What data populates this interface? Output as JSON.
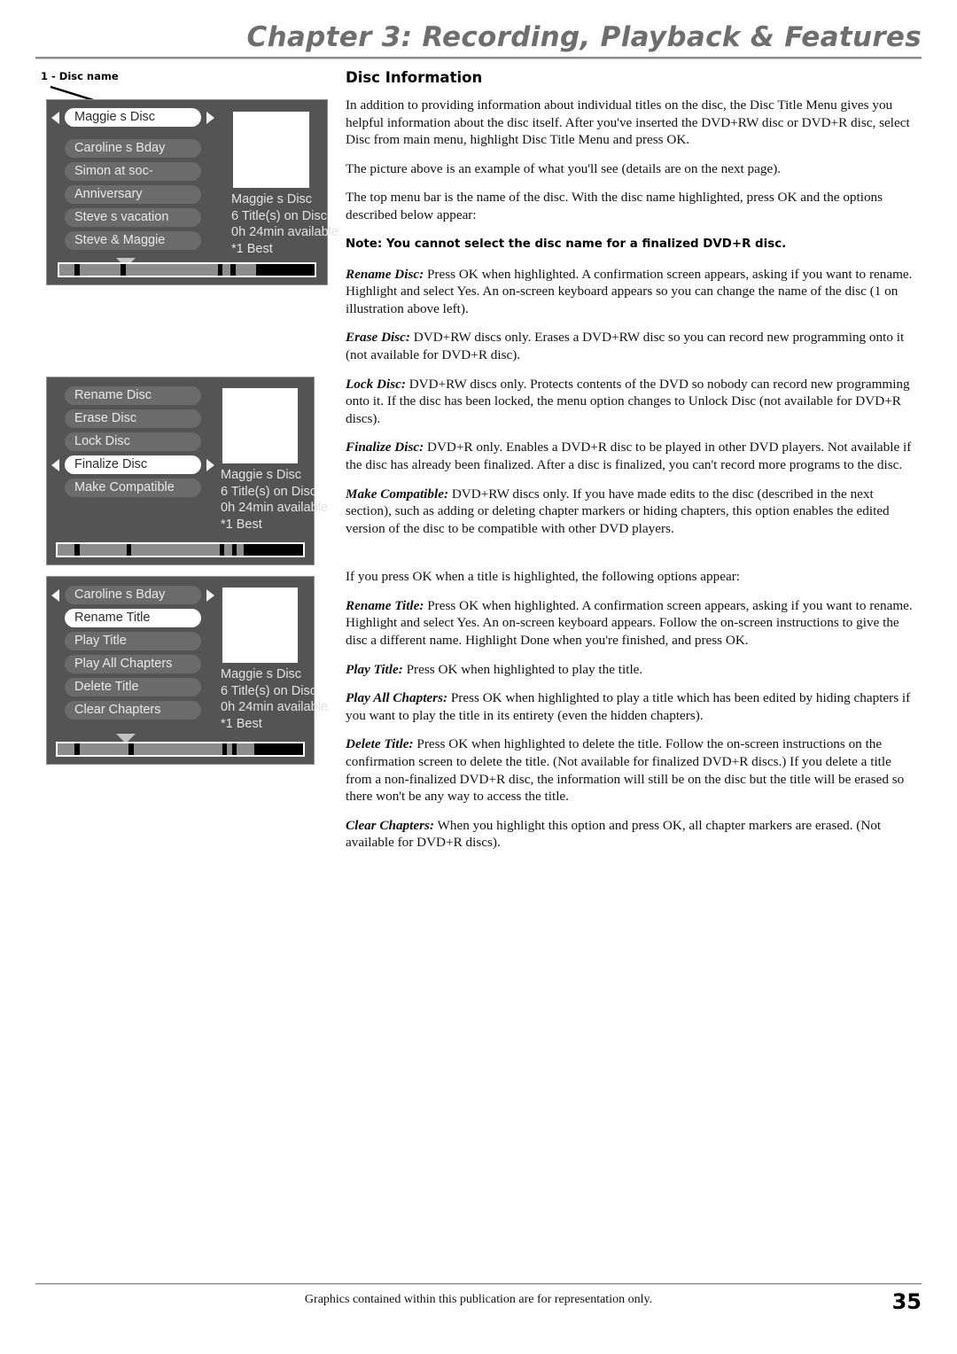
{
  "header": {
    "chapter_title": "Chapter 3: Recording, Playback & Features"
  },
  "callout": {
    "label": "1 - Disc name"
  },
  "screens": [
    {
      "name": "disc-title-menu",
      "top_bar": {
        "label": "Maggie s Disc",
        "selected": true,
        "arrows": true
      },
      "items": [
        {
          "label": "Caroline s Bday",
          "selected": false
        },
        {
          "label": "Simon at soc-",
          "selected": false
        },
        {
          "label": "Anniversary",
          "selected": false
        },
        {
          "label": "Steve s vacation",
          "selected": false
        },
        {
          "label": "Steve & Maggie",
          "selected": false
        }
      ],
      "more_indicator": "down-arrow",
      "info": {
        "disc_name": "Maggie s Disc",
        "titles_on_disc": "6 Title(s) on Disc",
        "time_available": "0h 24min available",
        "record_mode": "*1 Best"
      },
      "progress_segments": [
        6,
        2,
        16,
        2,
        36,
        2,
        3,
        2,
        8,
        23
      ]
    },
    {
      "name": "disc-options-menu",
      "top_bar": null,
      "items": [
        {
          "label": "Rename Disc",
          "selected": false
        },
        {
          "label": "Erase Disc",
          "selected": false
        },
        {
          "label": "Lock Disc",
          "selected": false
        },
        {
          "label": "Finalize Disc",
          "selected": true,
          "arrows": true
        },
        {
          "label": "Make Compatible",
          "selected": false
        }
      ],
      "more_indicator": null,
      "info": {
        "disc_name": "Maggie s Disc",
        "titles_on_disc": "6 Title(s) on Disc",
        "time_available": "0h 24min available",
        "record_mode": "*1 Best"
      },
      "progress_segments": [
        7,
        2,
        19,
        2,
        36,
        2,
        3,
        2,
        3,
        24
      ]
    },
    {
      "name": "title-options-menu",
      "top_bar": {
        "label": "Caroline s Bday",
        "selected": false,
        "arrows": true
      },
      "items": [
        {
          "label": "Rename Title",
          "selected": true
        },
        {
          "label": "Play Title",
          "selected": false
        },
        {
          "label": "Play All Chapters",
          "selected": false
        },
        {
          "label": "Delete Title",
          "selected": false
        },
        {
          "label": "Clear Chapters",
          "selected": false
        }
      ],
      "more_indicator": "down-arrow",
      "info": {
        "disc_name": "Maggie s Disc",
        "titles_on_disc": "6 Title(s) on Disc",
        "time_available": "0h 24min available",
        "record_mode": "*1 Best"
      },
      "progress_segments": [
        7,
        2,
        20,
        2,
        36,
        2,
        2,
        2,
        7,
        20
      ]
    }
  ],
  "main": {
    "section_title": "Disc Information",
    "intro_paragraphs": [
      "In addition to providing information about individual titles on the disc, the Disc Title Menu gives you helpful information about the disc itself. After you've inserted the DVD+RW disc or DVD+R disc, select Disc from main menu, highlight Disc Title Menu and press OK.",
      "The picture above is an example of what you'll see (details are on the next page).",
      "The top menu bar is the name of the disc. With the disc name highlighted, press OK and the options described below appear:"
    ],
    "note": "Note: You cannot select the disc name for a finalized DVD+R disc.",
    "disc_options": [
      {
        "lead": "Rename Disc:",
        "text": " Press OK when highlighted. A confirmation screen appears, asking if you want to rename. Highlight and select Yes. An on-screen keyboard appears so you can change the name of the disc (1 on illustration above left)."
      },
      {
        "lead": "Erase Disc:",
        "text": " DVD+RW discs only. Erases a DVD+RW disc so you can record new programming onto it (not available for DVD+R disc)."
      },
      {
        "lead": "Lock Disc:",
        "text": " DVD+RW discs only. Protects contents of the DVD so nobody can record new programming onto it. If the disc has been locked, the menu option changes to Unlock Disc (not available for DVD+R discs)."
      },
      {
        "lead": "Finalize Disc:",
        "text": " DVD+R only. Enables a DVD+R disc to be played in other DVD players. Not available if the disc has already been finalized. After a disc is finalized, you can't record more programs to the disc."
      },
      {
        "lead": "Make Compatible:",
        "text": " DVD+RW discs only. If you have made edits to the disc (described in the next section), such as adding or deleting chapter markers or hiding chapters, this option enables the edited version of the disc to be compatible with other DVD players."
      }
    ],
    "title_intro": "If you press OK when a title is highlighted, the following options appear:",
    "title_options": [
      {
        "lead": "Rename Title:",
        "text": " Press OK when highlighted. A confirmation screen appears, asking if you want to rename. Highlight and select Yes. An on-screen keyboard appears. Follow the on-screen instructions to give the disc a different name. Highlight Done when you're finished, and press OK."
      },
      {
        "lead": "Play Title:",
        "text": " Press OK when highlighted to play the title."
      },
      {
        "lead": "Play All Chapters:",
        "text": " Press OK when highlighted to play a title which has been edited by hiding chapters if you want to play the title in its entirety (even the hidden chapters)."
      },
      {
        "lead": "Delete Title:",
        "text": " Press OK when highlighted to delete the title. Follow the on-screen instructions on the confirmation screen to delete the title. (Not available for finalized DVD+R discs.) If you delete a title from a non-finalized DVD+R disc, the information will still be on the disc but the title will be erased so there won't be any way to access the title."
      },
      {
        "lead": "Clear Chapters:",
        "text": "  When you highlight this option and press OK, all chapter markers are erased. (Not available for DVD+R discs)."
      }
    ]
  },
  "footer": {
    "note": "Graphics contained within this publication are for representation only.",
    "page_number": "35"
  },
  "colors": {
    "header_gray": "#6e6e6e",
    "tv_background": "#545454",
    "pill_background": "#6b6b6b",
    "pill_selected": "#ffffff",
    "bar_segment": "#8c8c8c"
  }
}
